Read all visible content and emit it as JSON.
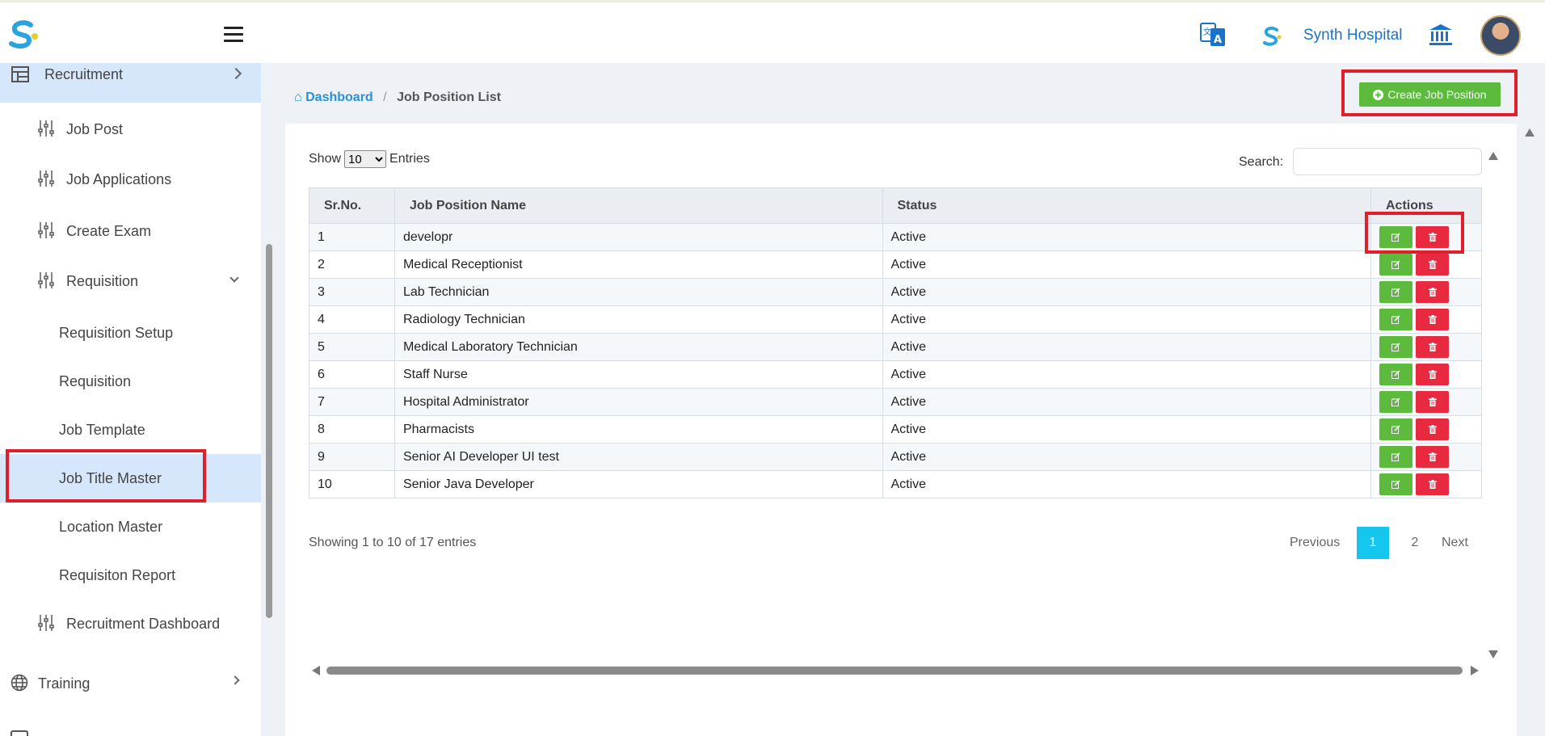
{
  "header": {
    "hospital_name": "Synth Hospital",
    "icons": [
      "app-logo-icon",
      "menu-icon",
      "translate-icon",
      "hospital-logo-icon",
      "bank-icon",
      "avatar"
    ]
  },
  "sidebar": {
    "recruitment": "Recruitment",
    "job_post": "Job Post",
    "job_applications": "Job Applications",
    "create_exam": "Create Exam",
    "requisition_group": "Requisition",
    "requisition_setup": "Requisition Setup",
    "requisition": "Requisition",
    "job_template": "Job Template",
    "job_title_master": "Job Title Master",
    "location_master": "Location Master",
    "requisition_report": "Requisiton Report",
    "recruitment_dashboard": "Recruitment Dashboard",
    "training": "Training"
  },
  "breadcrumb": {
    "home": "Dashboard",
    "current": "Job Position List"
  },
  "create_button": "Create Job Position",
  "controls": {
    "show_label": "Show",
    "show_value": "10",
    "entries_label": "Entries",
    "search_label": "Search:"
  },
  "table": {
    "headers": [
      "Sr.No.",
      "Job Position Name",
      "Status",
      "Actions"
    ],
    "rows": [
      {
        "sr": "1",
        "name": "developr",
        "status": "Active"
      },
      {
        "sr": "2",
        "name": "Medical Receptionist",
        "status": "Active"
      },
      {
        "sr": "3",
        "name": "Lab Technician",
        "status": "Active"
      },
      {
        "sr": "4",
        "name": "Radiology Technician",
        "status": "Active"
      },
      {
        "sr": "5",
        "name": "Medical Laboratory Technician",
        "status": "Active"
      },
      {
        "sr": "6",
        "name": "Staff Nurse",
        "status": "Active"
      },
      {
        "sr": "7",
        "name": "Hospital Administrator",
        "status": "Active"
      },
      {
        "sr": "8",
        "name": "Pharmacists",
        "status": "Active"
      },
      {
        "sr": "9",
        "name": "Senior AI Developer UI test",
        "status": "Active"
      },
      {
        "sr": "10",
        "name": "Senior Java Developer",
        "status": "Active"
      }
    ]
  },
  "footer": {
    "info": "Showing 1 to 10 of 17 entries",
    "previous": "Previous",
    "page1": "1",
    "page2": "2",
    "next": "Next"
  },
  "colors": {
    "accent_green": "#5cba3c",
    "danger_red": "#e8293f",
    "link_blue": "#2c8fd6",
    "active_page": "#15c6ef",
    "highlight_box": "#e01f2a"
  }
}
